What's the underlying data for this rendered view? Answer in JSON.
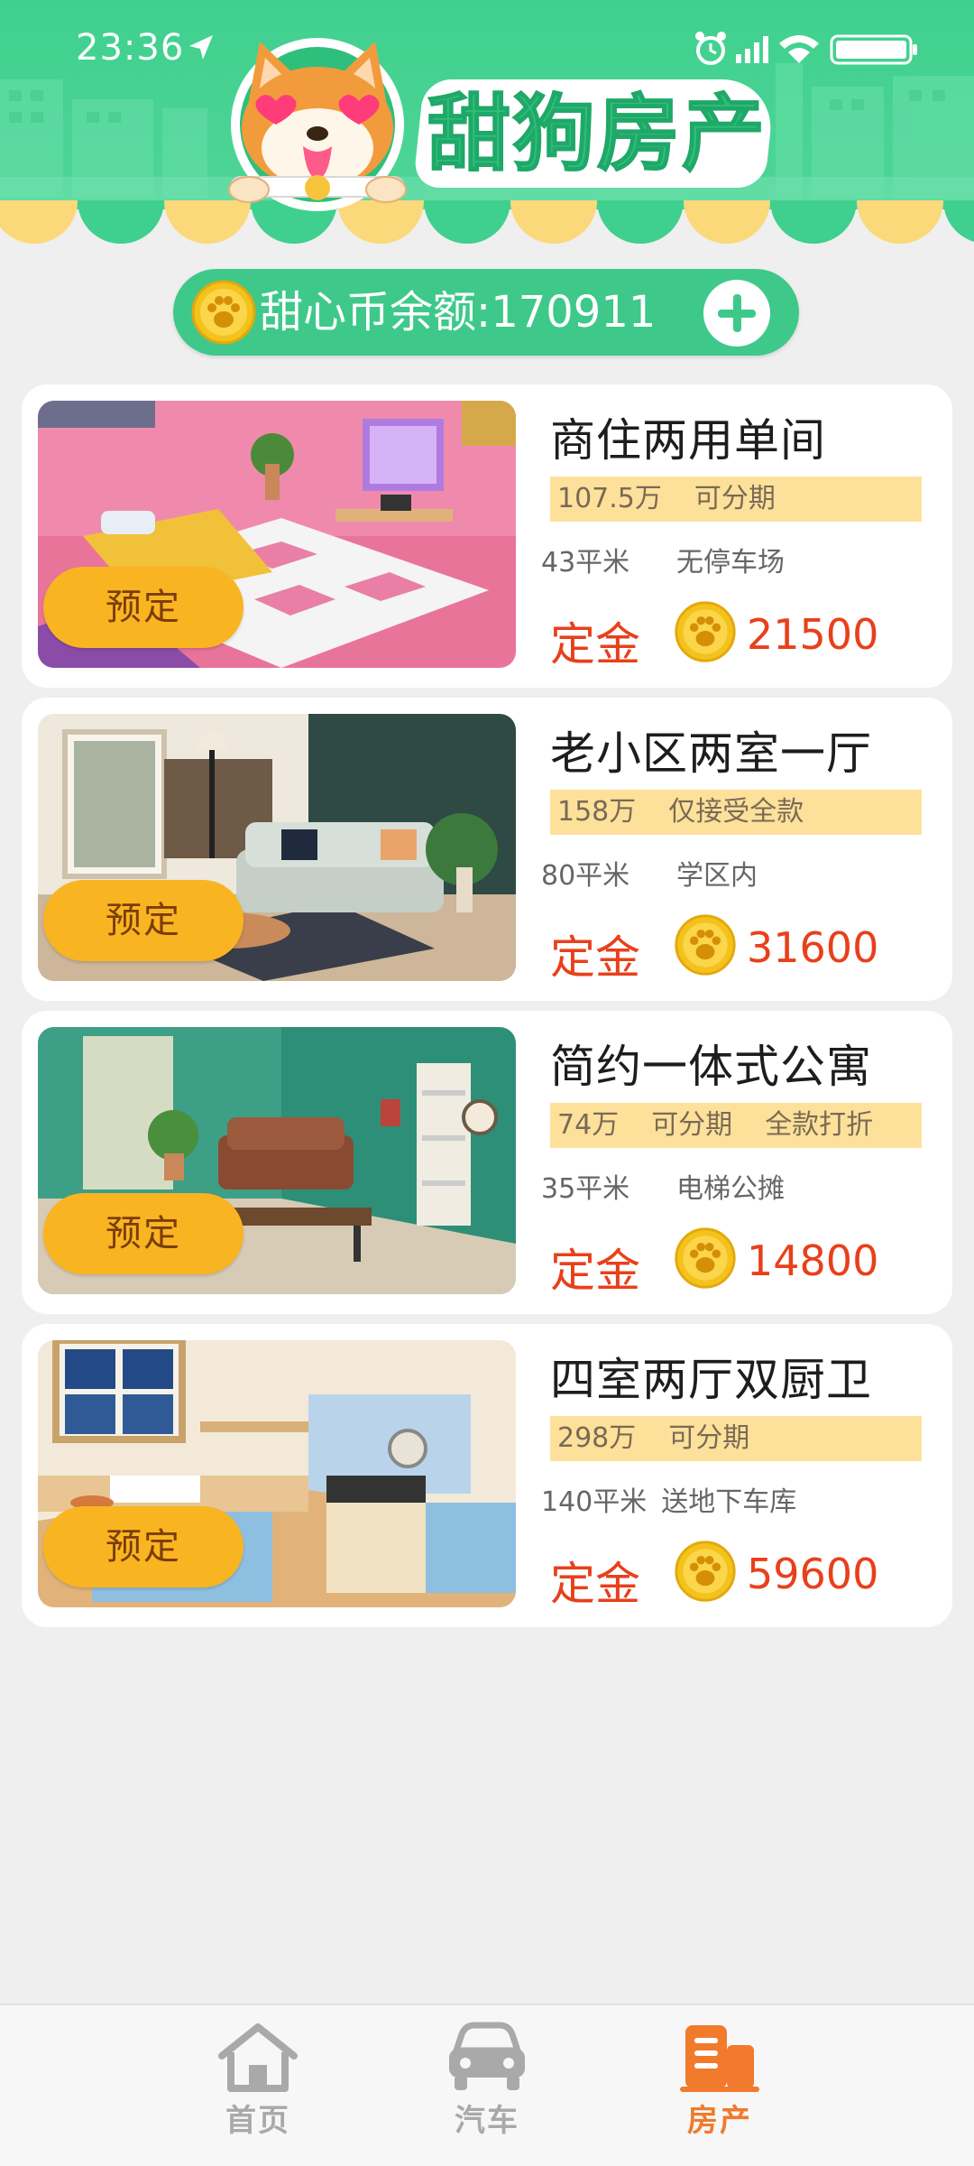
{
  "status_bar": {
    "time": "23:36"
  },
  "app": {
    "logo_title": "甜狗房产"
  },
  "balance": {
    "label": "甜心币余额:",
    "value": "170911"
  },
  "listings": [
    {
      "title": "商住两用单间",
      "tags": [
        "107.5万",
        "可分期"
      ],
      "area": "43平米",
      "feature": "无停车场",
      "deposit_label": "定金",
      "deposit": "21500",
      "button": "预定"
    },
    {
      "title": "老小区两室一厅",
      "tags": [
        "158万",
        "仅接受全款"
      ],
      "area": "80平米",
      "feature": "学区内",
      "deposit_label": "定金",
      "deposit": "31600",
      "button": "预定"
    },
    {
      "title": "简约一体式公寓",
      "tags": [
        "74万",
        "可分期",
        "全款打折"
      ],
      "area": "35平米",
      "feature": "电梯公摊",
      "deposit_label": "定金",
      "deposit": "14800",
      "button": "预定"
    },
    {
      "title": "四室两厅双厨卫",
      "tags": [
        "298万",
        "可分期"
      ],
      "area": "140平米",
      "feature": "送地下车库",
      "deposit_label": "定金",
      "deposit": "59600",
      "button": "预定"
    }
  ],
  "bottom_nav": {
    "items": [
      {
        "label": "首页",
        "icon": "home-icon",
        "active": false
      },
      {
        "label": "汽车",
        "icon": "car-icon",
        "active": false
      },
      {
        "label": "房产",
        "icon": "building-icon",
        "active": true
      }
    ]
  },
  "colors": {
    "brand_green": "#3ec98a",
    "accent_orange": "#f17a2c",
    "price_red": "#e8401b",
    "button_yellow": "#f9b421",
    "tag_bg": "#fde19b"
  }
}
